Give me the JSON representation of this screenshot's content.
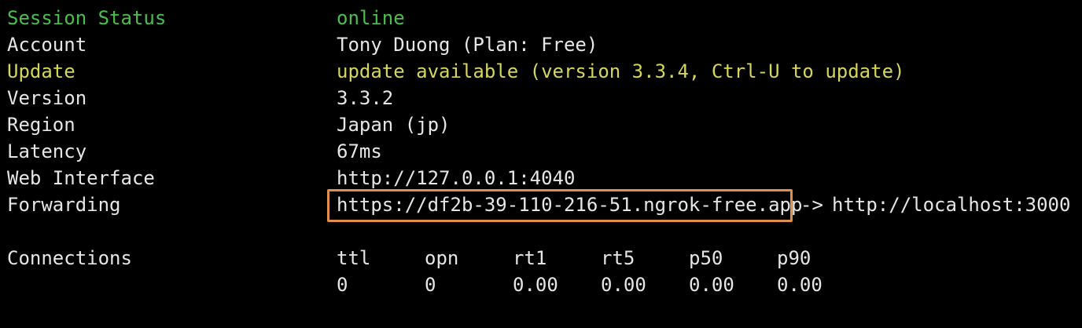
{
  "colors": {
    "background": "#000000",
    "text": "#e6e6e6",
    "status_green": "#4bbf4b",
    "update_yellow": "#d6d65a",
    "highlight_orange": "#e0904a"
  },
  "rows": [
    {
      "label": "Session Status",
      "value": "online"
    },
    {
      "label": "Account",
      "value": "Tony Duong (Plan: Free)"
    },
    {
      "label": "Update",
      "value": "update available (version 3.3.4, Ctrl-U to update)"
    },
    {
      "label": "Version",
      "value": "3.3.2"
    },
    {
      "label": "Region",
      "value": "Japan (jp)"
    },
    {
      "label": "Latency",
      "value": "67ms"
    },
    {
      "label": "Web Interface",
      "value": "http://127.0.0.1:4040"
    }
  ],
  "forwarding": {
    "label": "Forwarding",
    "public_url": "https://df2b-39-110-216-51.ngrok-free.app",
    "arrow": "->",
    "local_url": "http://localhost:3000"
  },
  "connections": {
    "label": "Connections",
    "headers": [
      "ttl",
      "opn",
      "rt1",
      "rt5",
      "p50",
      "p90"
    ],
    "values": [
      "0",
      "0",
      "0.00",
      "0.00",
      "0.00",
      "0.00"
    ]
  }
}
